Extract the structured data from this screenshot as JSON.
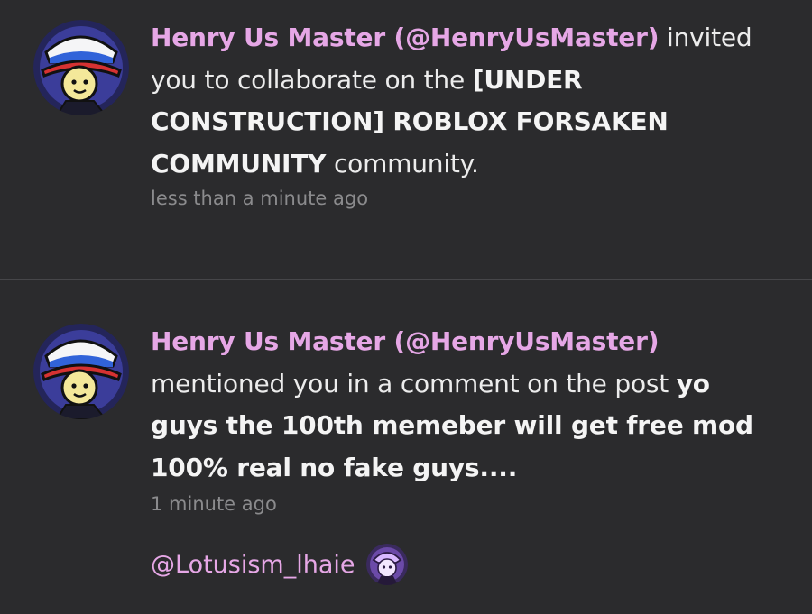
{
  "colors": {
    "background": "#2b2b2d",
    "divider": "#464649",
    "username": "#e6a7e6",
    "text": "#ececec",
    "timestamp": "#8b8b8d"
  },
  "notifications": [
    {
      "avatar": "henry-avatar-icon",
      "user": "Henry Us Master (@HenryUsMaster)",
      "action": " invited you to collaborate on the ",
      "target": "[UNDER CONSTRUCTION] ROBLOX FORSAKEN COMMUNITY",
      "suffix": " community.",
      "time": "less than a minute ago"
    },
    {
      "avatar": "henry-avatar-icon",
      "user": "Henry Us Master (@HenryUsMaster)",
      "action": " mentioned you in a comment on the post ",
      "target": "yo guys the 100th memeber will get free mod 100% real no fake guys....",
      "time": "1 minute ago",
      "mention": "@Lotusism_lhaie",
      "mention_avatar": "purple-character-avatar-icon"
    }
  ]
}
